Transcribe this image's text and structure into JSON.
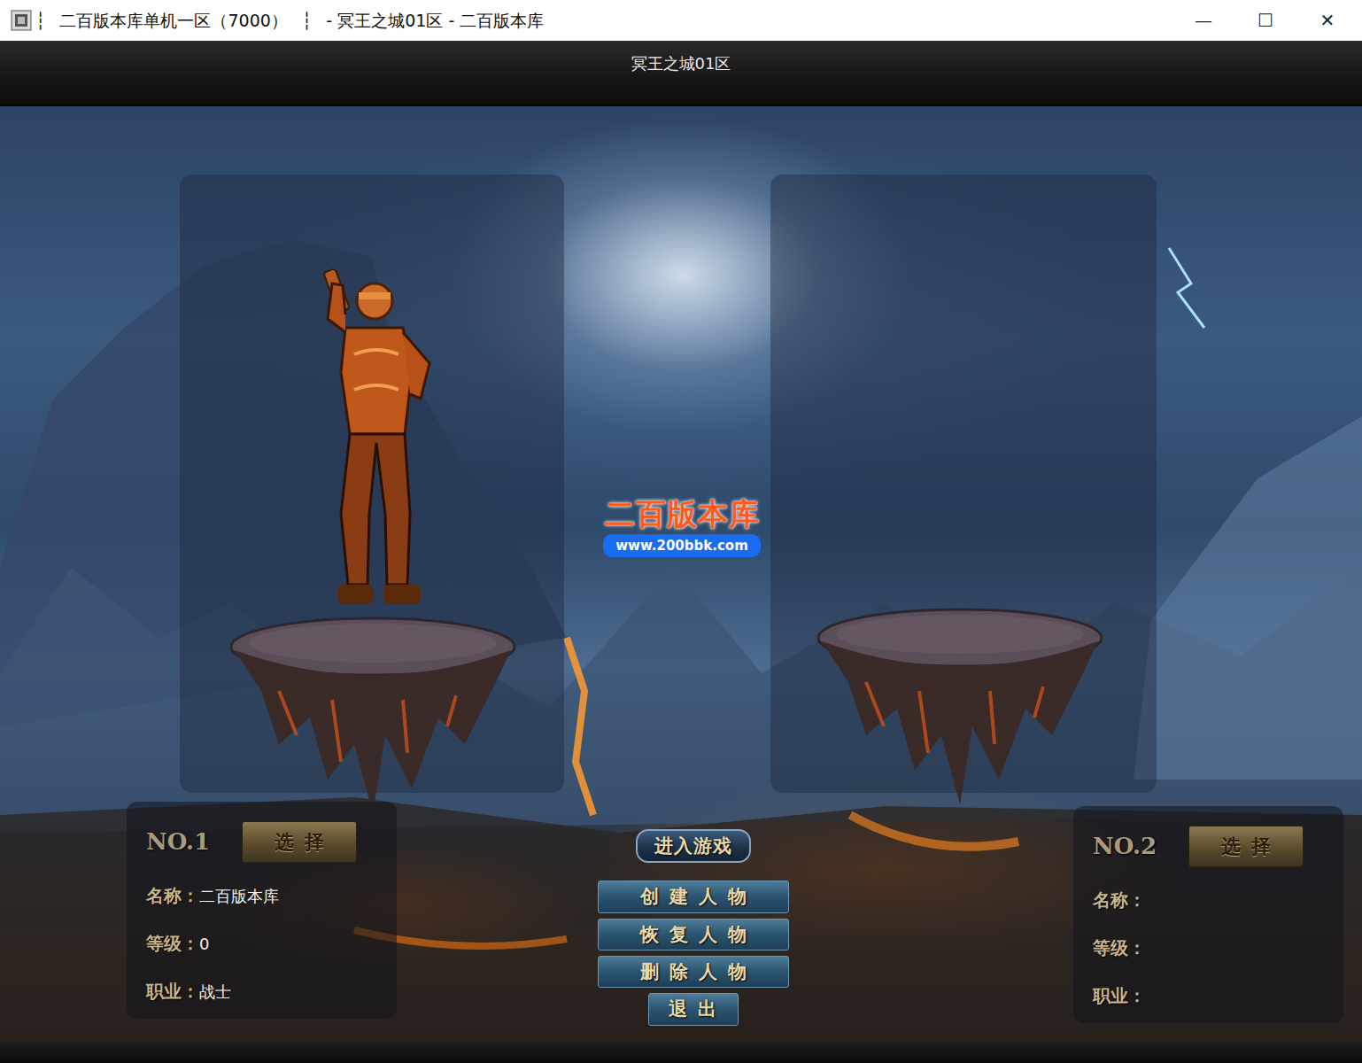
{
  "window": {
    "title_segments": [
      "┆",
      "二百版本库单机一区（7000）",
      "┆",
      "- 冥王之城01区 - 二百版本库"
    ],
    "controls": [
      "—",
      "☐",
      "✕"
    ]
  },
  "server_title": "冥王之城01区",
  "watermark": {
    "brand": "二百版本库",
    "url": "www.200bbk.com"
  },
  "slots": [
    {
      "number": "NO.1",
      "select_label": "选择",
      "has_character": true,
      "fields": [
        {
          "label": "名称：",
          "value": "二百版本库"
        },
        {
          "label": "等级：",
          "value": "0"
        },
        {
          "label": "职业：",
          "value": "战士"
        }
      ]
    },
    {
      "number": "NO.2",
      "select_label": "选择",
      "has_character": false,
      "fields": [
        {
          "label": "名称：",
          "value": ""
        },
        {
          "label": "等级：",
          "value": ""
        },
        {
          "label": "职业：",
          "value": ""
        }
      ]
    }
  ],
  "buttons": [
    {
      "label": "进入游戏",
      "kind": "primary"
    },
    {
      "label": "创建人物",
      "kind": "menu"
    },
    {
      "label": "恢复人物",
      "kind": "menu"
    },
    {
      "label": "删除人物",
      "kind": "menu"
    },
    {
      "label": "退出",
      "kind": "small"
    }
  ]
}
